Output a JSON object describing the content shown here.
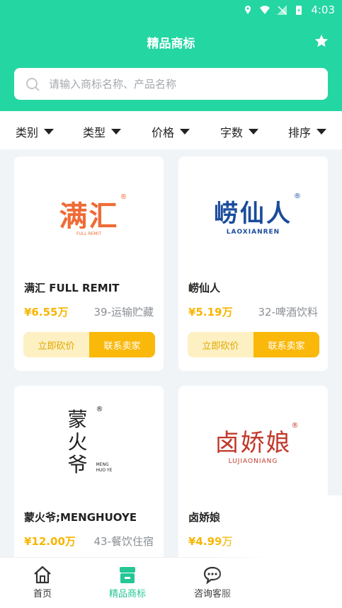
{
  "status_bar": {
    "time": "4:03"
  },
  "header": {
    "title": "精品商标"
  },
  "search": {
    "placeholder": "请输入商标名称、产品名称"
  },
  "filters": [
    "类别",
    "类型",
    "价格",
    "字数",
    "排序"
  ],
  "cards": [
    {
      "logo_text": "满汇",
      "logo_sub": "FULL REMIT",
      "name": "满汇 FULL REMIT",
      "price": "¥6.55万",
      "category": "39-运输贮藏",
      "bargain_label": "立即砍价",
      "contact_label": "联系卖家"
    },
    {
      "logo_text": "崂仙人",
      "logo_sub": "LAOXIANREN",
      "name": "崂仙人",
      "price": "¥5.19万",
      "category": "32-啤酒饮料",
      "bargain_label": "立即砍价",
      "contact_label": "联系卖家"
    },
    {
      "logo_text": "蒙火爷",
      "logo_sub": "MENG HUO YE",
      "name": "蒙火爷;MENGHUOYE",
      "price": "¥12.00万",
      "category": "43-餐饮住宿"
    },
    {
      "logo_text": "卤娇娘",
      "logo_sub": "LUJIAONIANG",
      "name": "卤娇娘",
      "price": "¥4.99万",
      "category": ""
    }
  ],
  "tabbar": [
    {
      "label": "首页",
      "icon": "home-icon"
    },
    {
      "label": "精品商标",
      "icon": "store-icon"
    },
    {
      "label": "咨询客服",
      "icon": "chat-icon"
    }
  ],
  "colors": {
    "accent": "#24d6a2",
    "price": "#f7b500",
    "button": "#fab80a"
  }
}
